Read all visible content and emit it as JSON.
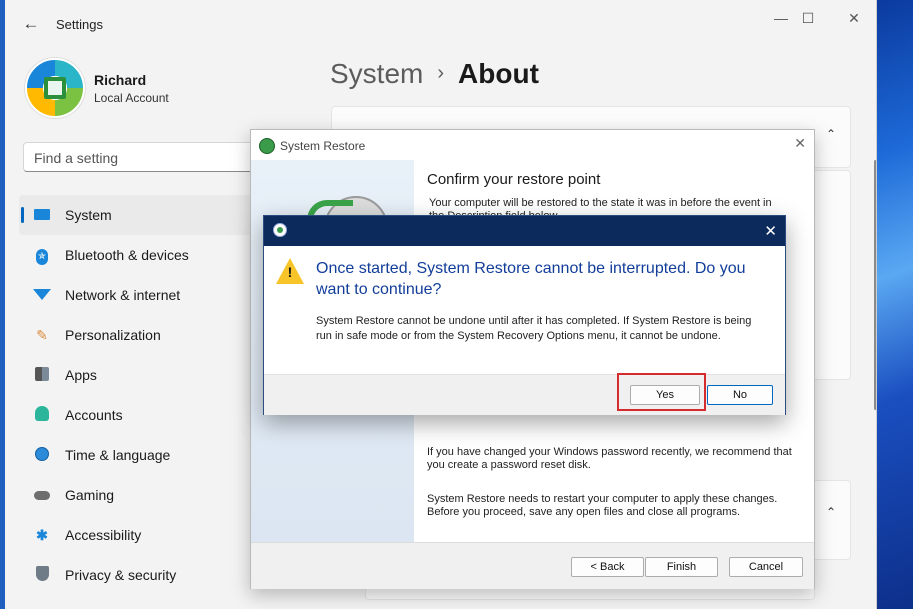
{
  "settings": {
    "app_title": "Settings",
    "user": {
      "name": "Richard",
      "account_type": "Local Account"
    },
    "search": {
      "placeholder": "Find a setting"
    },
    "nav_items": [
      {
        "label": "System",
        "icon": "monitor-icon",
        "active": true
      },
      {
        "label": "Bluetooth & devices",
        "icon": "bluetooth-icon"
      },
      {
        "label": "Network & internet",
        "icon": "wifi-icon"
      },
      {
        "label": "Personalization",
        "icon": "brush-icon"
      },
      {
        "label": "Apps",
        "icon": "apps-icon"
      },
      {
        "label": "Accounts",
        "icon": "person-icon"
      },
      {
        "label": "Time & language",
        "icon": "globe-clock-icon"
      },
      {
        "label": "Gaming",
        "icon": "gamepad-icon"
      },
      {
        "label": "Accessibility",
        "icon": "accessibility-icon"
      },
      {
        "label": "Privacy & security",
        "icon": "shield-icon"
      }
    ],
    "breadcrumb": {
      "parent": "System",
      "separator": "›",
      "current": "About"
    },
    "accent_color": "#0067c0"
  },
  "system_restore": {
    "title": "System Restore",
    "heading": "Confirm your restore point",
    "description": "Your computer will be restored to the state it was in before the event in the Description field below.",
    "password_note": "If you have changed your Windows password recently, we recommend that you create a password reset disk.",
    "restart_note": "System Restore needs to restart your computer to apply these changes. Before you proceed, save any open files and close all programs.",
    "buttons": {
      "back": "< Back",
      "finish": "Finish",
      "cancel": "Cancel"
    }
  },
  "confirm_dialog": {
    "main_instruction": "Once started, System Restore cannot be interrupted. Do you want to continue?",
    "body": "System Restore cannot be undone until after it has completed. If System Restore is being run in safe mode or from the System Recovery Options menu, it cannot be undone.",
    "buttons": {
      "yes": "Yes",
      "no": "No"
    },
    "title_bar_color": "#0c2b5c",
    "highlight_color": "#d42c2c"
  }
}
